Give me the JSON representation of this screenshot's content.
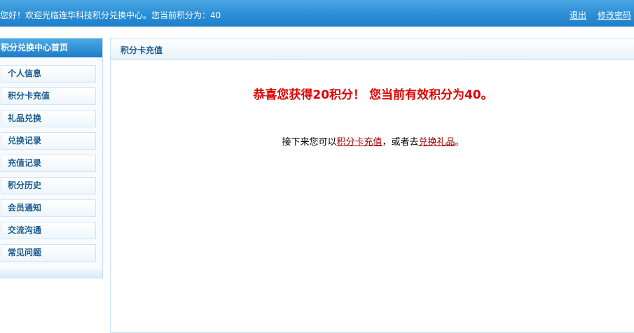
{
  "header": {
    "welcome": "您好！欢迎光临连华科技积分兑换中心。您当前积分为：40",
    "logout": "退出",
    "change_password": "修改密码"
  },
  "sidebar": {
    "title": "积分兑换中心首页",
    "items": [
      {
        "label": "个人信息"
      },
      {
        "label": "积分卡充值"
      },
      {
        "label": "礼品兑换"
      },
      {
        "label": "兑换记录"
      },
      {
        "label": "充值记录"
      },
      {
        "label": "积分历史"
      },
      {
        "label": "会员通知"
      },
      {
        "label": "交流沟通"
      },
      {
        "label": "常见问题"
      }
    ]
  },
  "main": {
    "title": "积分卡充值",
    "message": "恭喜您获得20积分！ 您当前有效积分为40。",
    "next": {
      "prefix": "接下来您可以",
      "link1": "积分卡充值",
      "middle": "，或者去",
      "link2": "兑换礼品",
      "suffix": "。"
    }
  }
}
